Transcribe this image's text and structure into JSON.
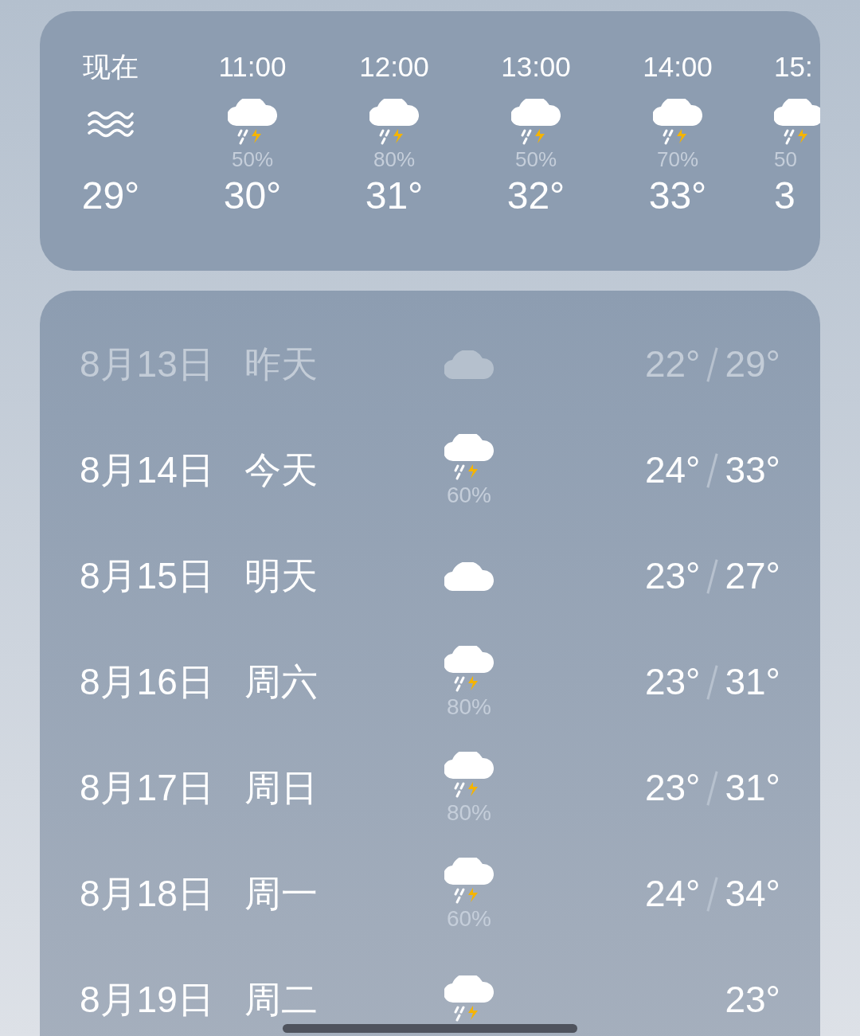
{
  "hourly": [
    {
      "time": "现在",
      "kind": "haze",
      "temp": "29°"
    },
    {
      "time": "11:00",
      "kind": "thunder",
      "precip": "50%",
      "temp": "30°"
    },
    {
      "time": "12:00",
      "kind": "thunder",
      "precip": "80%",
      "temp": "31°"
    },
    {
      "time": "13:00",
      "kind": "thunder",
      "precip": "50%",
      "temp": "32°"
    },
    {
      "time": "14:00",
      "kind": "thunder",
      "precip": "70%",
      "temp": "33°"
    },
    {
      "time": "15:",
      "kind": "thunder",
      "precip": "50",
      "temp": "3"
    }
  ],
  "daily": [
    {
      "date": "8月13日",
      "day": "昨天",
      "kind": "cloudy",
      "low": "22°",
      "high": "29°",
      "past": true
    },
    {
      "date": "8月14日",
      "day": "今天",
      "kind": "thunder",
      "precip": "60%",
      "low": "24°",
      "high": "33°",
      "past": false
    },
    {
      "date": "8月15日",
      "day": "明天",
      "kind": "cloudy",
      "low": "23°",
      "high": "27°",
      "past": false
    },
    {
      "date": "8月16日",
      "day": "周六",
      "kind": "thunder",
      "precip": "80%",
      "low": "23°",
      "high": "31°",
      "past": false
    },
    {
      "date": "8月17日",
      "day": "周日",
      "kind": "thunder",
      "precip": "80%",
      "low": "23°",
      "high": "31°",
      "past": false
    },
    {
      "date": "8月18日",
      "day": "周一",
      "kind": "thunder",
      "precip": "60%",
      "low": "24°",
      "high": "34°",
      "past": false
    },
    {
      "date": "8月19日",
      "day": "周二",
      "kind": "thunder",
      "low": "23°",
      "past": false
    }
  ]
}
